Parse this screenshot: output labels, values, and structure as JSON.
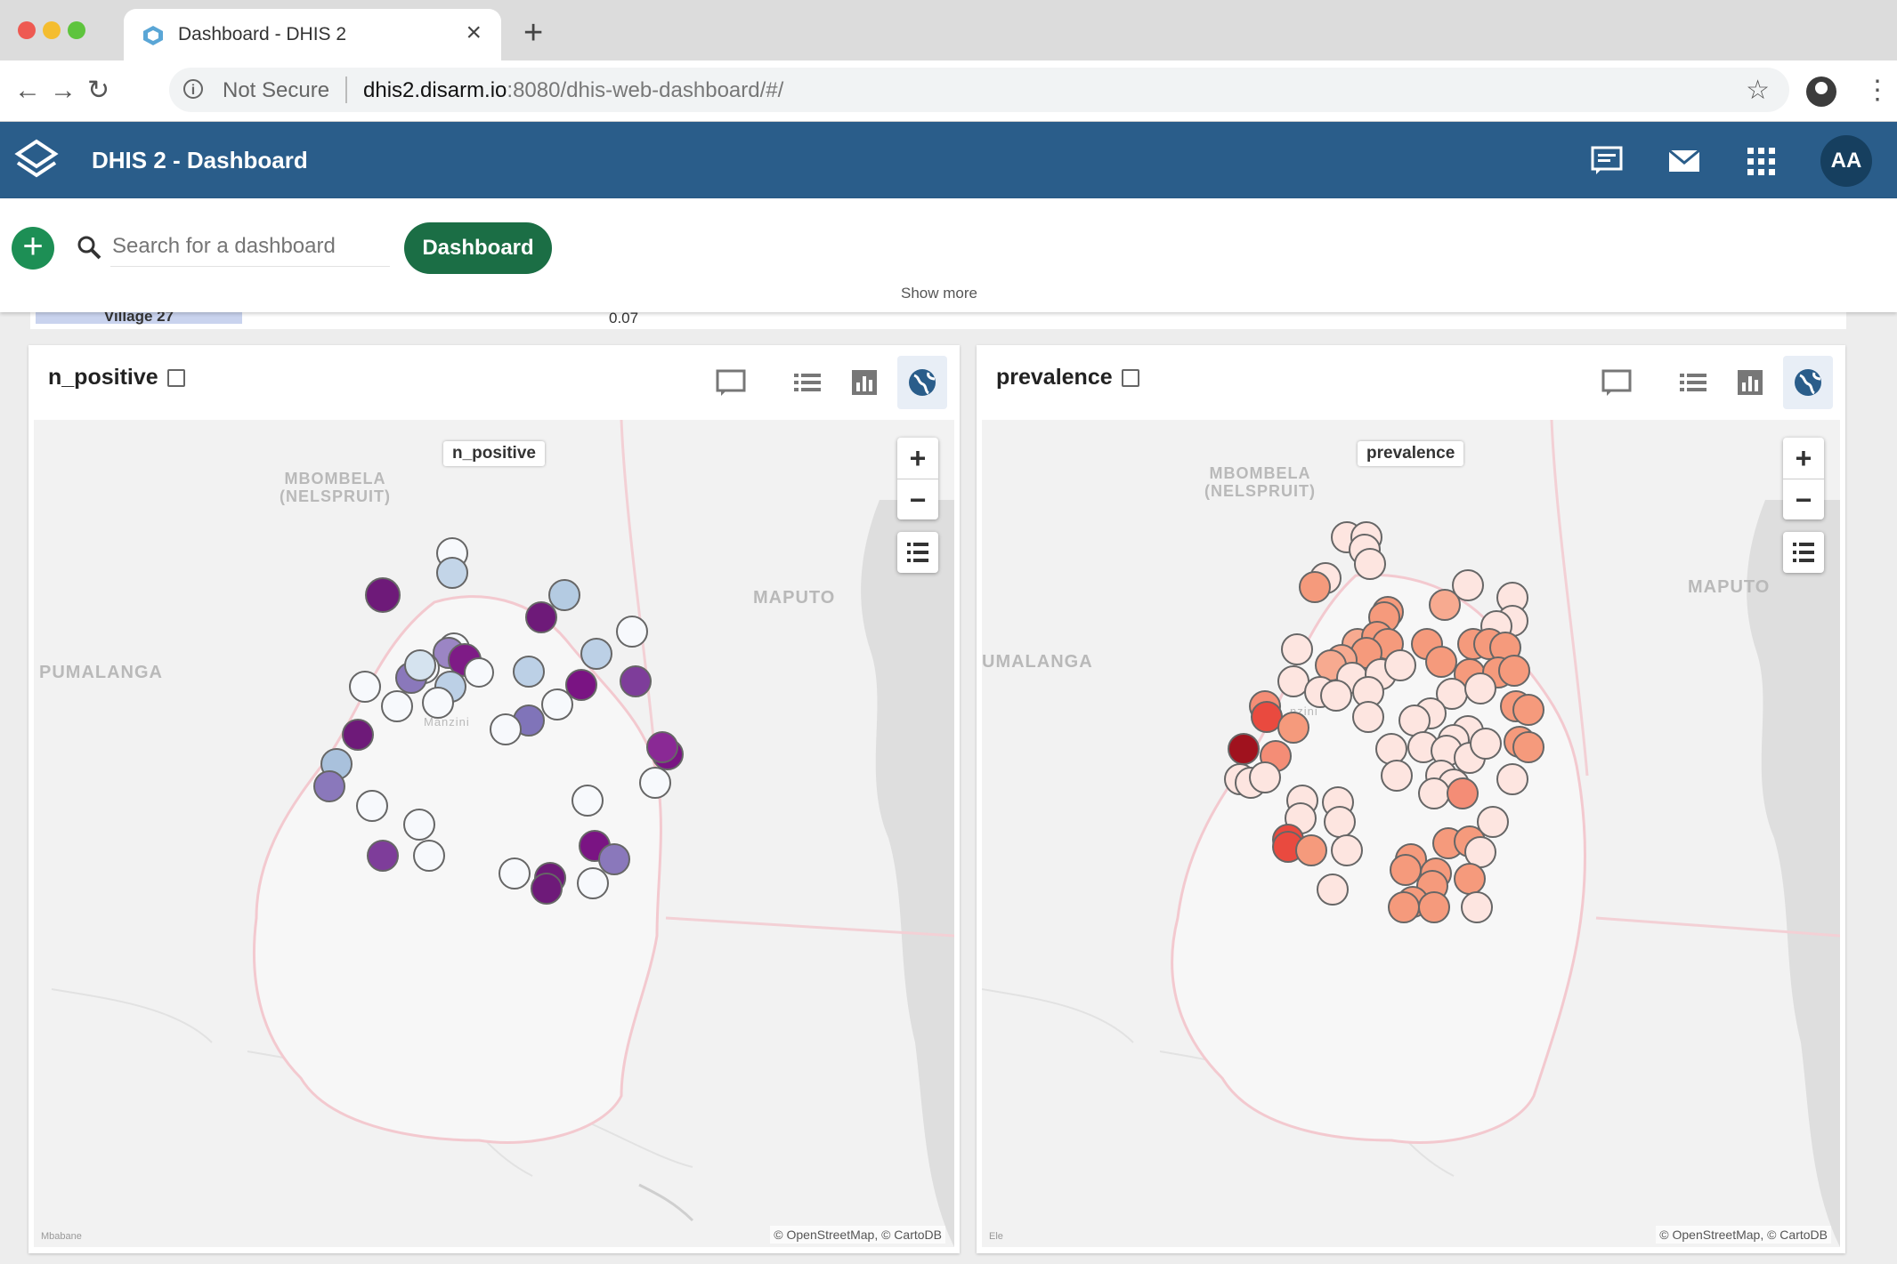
{
  "browser": {
    "tab_title": "Dashboard - DHIS 2",
    "not_secure": "Not Secure",
    "url_host": "dhis2.disarm.io",
    "url_path": ":8080/dhis-web-dashboard/#/"
  },
  "header": {
    "title": "DHIS 2 - Dashboard",
    "avatar_initials": "AA",
    "color": "#2a5d8a"
  },
  "dashboard_bar": {
    "search_placeholder": "Search for a dashboard",
    "chip_label": "Dashboard",
    "show_more": "Show more"
  },
  "behind_row": {
    "label": "Village 27",
    "value": "0.07"
  },
  "panels": [
    {
      "title": "n_positive",
      "legend_label": "n_positive",
      "labels": {
        "mbombela": "MBOMBELA",
        "nelspruit": "(NELSPRUIT)",
        "maputo": "MAPUTO",
        "pumalanga": "PUMALANGA",
        "manzini": "Manzini"
      },
      "attribution": "© OpenStreetMap, © CartoDB",
      "small": "Mbabane"
    },
    {
      "title": "prevalence",
      "legend_label": "prevalence",
      "labels": {
        "mbombela": "MBOMBELA",
        "nelspruit": "(NELSPRUIT)",
        "maputo": "MAPUTO",
        "pumalanga": "UMALANGA",
        "manzini": "nzini"
      },
      "attribution": "© OpenStreetMap, © CartoDB",
      "small": "Ele"
    }
  ],
  "icons": {
    "interpretations": "comment-icon",
    "table": "table-icon",
    "chart": "chart-icon",
    "map": "globe-icon"
  }
}
